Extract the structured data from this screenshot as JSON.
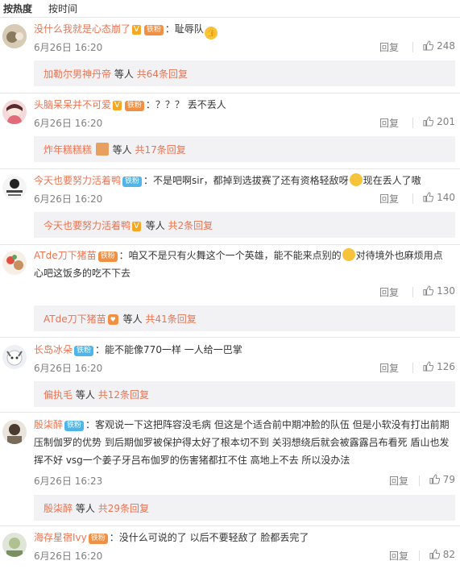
{
  "sort": {
    "hot": "按热度",
    "time": "按时间"
  },
  "vip_label": "V",
  "badge_label": "铁粉",
  "reply_label": "回复",
  "comments": [
    {
      "user": "没什么我就是心态崩了",
      "colon": "：",
      "text": "耻辱队",
      "date": "6月26日 16:20",
      "likes": "248",
      "sub": {
        "user": "加勒尔男神丹帝",
        "mid": "等人",
        "more": "共64条回复"
      }
    },
    {
      "user": "头脑呆呆并不可爱",
      "colon": "：",
      "text": "？？？ 丢不丢人",
      "date": "6月26日 16:20",
      "likes": "201",
      "sub": {
        "user": "炸年糕糕糕",
        "mid": "等人",
        "more": "共17条回复"
      }
    },
    {
      "user": "今天也要努力活着鸭",
      "colon": "：",
      "text": "不是吧啊sir，都掉到选拔赛了还有资格轻敌呀",
      "text2": "现在丢人了嗷",
      "date": "6月26日 16:20",
      "likes": "140",
      "sub": {
        "user": "今天也要努力活着鸭",
        "mid": "等人",
        "more": "共2条回复"
      }
    },
    {
      "user": "ATde刀下猪苗",
      "colon": "：",
      "text": "咱又不是只有火舞这个一个英雄，能不能来点别的",
      "text2": "对待境外也麻烦用点",
      "line2": "心吧这饭多的吃不下去",
      "date": "6月26日 16:20",
      "likes": "130",
      "sub": {
        "user": "ATde刀下猪苗",
        "mid": "等人",
        "more": "共41条回复"
      }
    },
    {
      "user": "长岛冰朵",
      "colon": "：",
      "text": "能不能像770一样 一人给一巴掌",
      "date": "6月26日 16:20",
      "likes": "126",
      "sub": {
        "user": "偏执毛",
        "mid": "等人",
        "more": "共12条回复"
      }
    },
    {
      "user": "殷柒醉",
      "colon": "：",
      "text": "客观说一下这把阵容没毛病 但这是个适合前中期冲脸的队伍 但是小软没有打出前期",
      "line2": "压制伽罗的优势 到后期伽罗被保护得太好了根本切不到 关羽想绕后就会被露露吕布看死 盾山也发",
      "line3": "挥不好 vsg一个姜子牙吕布伽罗的伤害猪都扛不住 高地上不去 所以没办法",
      "date": "6月26日 16:23",
      "likes": "79",
      "sub": {
        "user": "殷柒醉",
        "mid": "等人",
        "more": "共29条回复"
      }
    },
    {
      "user": "海存星宿Ivy",
      "colon": "：",
      "text": "没什么可说的了 以后不要轻敌了 脸都丢完了",
      "date": "6月26日 16:20",
      "likes": "82"
    }
  ]
}
